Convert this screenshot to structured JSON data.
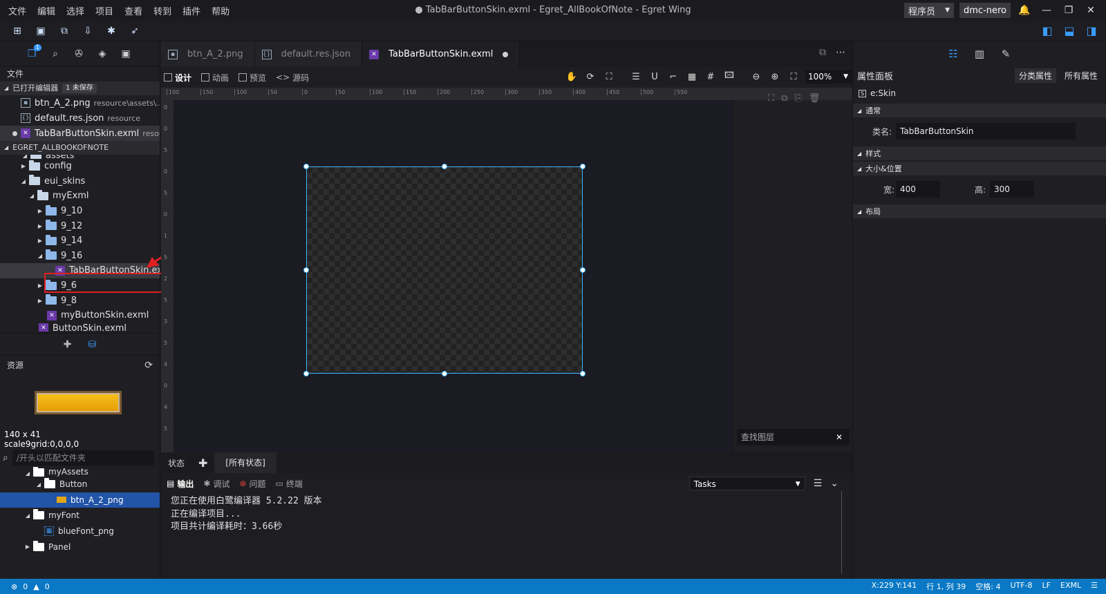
{
  "menu": [
    "文件",
    "编辑",
    "选择",
    "项目",
    "查看",
    "转到",
    "插件",
    "帮助"
  ],
  "window_title": "● TabBarButtonSkin.exml - Egret_AllBookOfNote - Egret Wing",
  "role": "程序员",
  "user": "dmc-nero",
  "left": {
    "files_label": "文件",
    "open_editors": "已打开编辑器",
    "unsaved": "1 未保存",
    "open_files": [
      {
        "name": "btn_A_2.png",
        "path": "resource\\assets\\..."
      },
      {
        "name": "default.res.json",
        "path": "resource"
      },
      {
        "name": "TabBarButtonSkin.exml",
        "path": "resour..."
      }
    ],
    "project": "EGRET_ALLBOOKOFNOTE",
    "tree": [
      "assets",
      "config",
      "eui_skins",
      "myExml",
      "9_10",
      "9_12",
      "9_14",
      "9_16",
      "TabBarButtonSkin.exml",
      "9_6",
      "9_8",
      "myButtonSkin.exml",
      "ButtonSkin.exml"
    ],
    "resources_label": "资源",
    "res_size": "140 x 41",
    "res_scale9": "scale9grid:0,0,0,0",
    "res_search_placeholder": "/开头以匹配文件夹",
    "res_tree": [
      "myAssets",
      "Button",
      "btn_A_2_png",
      "myFont",
      "blueFont_png",
      "Panel"
    ]
  },
  "tabs": [
    "btn_A_2.png",
    "default.res.json",
    "TabBarButtonSkin.exml"
  ],
  "modes": [
    "设计",
    "动画",
    "预览",
    "源码"
  ],
  "zoom": "100%",
  "ruler_h": [
    "100",
    "150",
    "100",
    "50",
    "0",
    "50",
    "100",
    "150",
    "200",
    "250",
    "300",
    "350",
    "400",
    "450",
    "500",
    "550"
  ],
  "ruler_v": [
    "0",
    "0",
    "5",
    "0",
    "5",
    "0",
    "1",
    "5",
    "2",
    "5",
    "3",
    "5",
    "4",
    "0",
    "4",
    "5"
  ],
  "layer_search": "查找图层",
  "state": {
    "label": "状态",
    "all": "[所有状态]"
  },
  "output": {
    "tabs": [
      "输出",
      "调试",
      "问题",
      "终端"
    ],
    "tasks": "Tasks",
    "lines": [
      "您正在使用白鹭编译器 5.2.22 版本",
      "正在编译项目...",
      "项目共计编译耗时：3.66秒"
    ]
  },
  "right": {
    "title": "属性面板",
    "tab_category": "分类属性",
    "tab_all": "所有属性",
    "skin": "e:Skin",
    "sec_common": "通常",
    "class_label": "类名:",
    "class_value": "TabBarButtonSkin",
    "sec_style": "样式",
    "sec_size": "大小&位置",
    "width_label": "宽:",
    "width_value": "400",
    "height_label": "高:",
    "height_value": "300",
    "sec_layout": "布局"
  },
  "status": {
    "errors": "0",
    "warnings": "0",
    "coords": "X:229 Y:141",
    "line_col": "行 1, 列 39",
    "spaces": "空格: 4",
    "encoding": "UTF-8",
    "eol": "LF",
    "lang": "EXML"
  }
}
